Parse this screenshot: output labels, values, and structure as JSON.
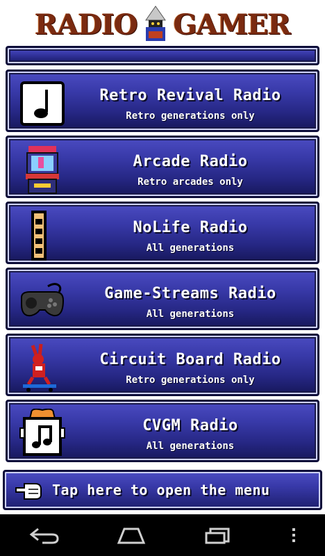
{
  "header": {
    "logo_left": "RADIO",
    "logo_right": "GAMER"
  },
  "stations": [
    {
      "title": "Retro Revival Radio",
      "subtitle": "Retro generations only",
      "icon": "music-note-icon"
    },
    {
      "title": "Arcade Radio",
      "subtitle": "Retro arcades only",
      "icon": "arcade-cabinet-icon"
    },
    {
      "title": "NoLife Radio",
      "subtitle": "All generations",
      "icon": "nolife-logo-icon"
    },
    {
      "title": "Game-Streams Radio",
      "subtitle": "All generations",
      "icon": "gamepad-icon"
    },
    {
      "title": "Circuit Board Radio",
      "subtitle": "Retro generations only",
      "icon": "rabbit-skateboard-icon"
    },
    {
      "title": "CVGM Radio",
      "subtitle": "All generations",
      "icon": "cvgm-music-icon"
    }
  ],
  "bottom": {
    "menu_label": "Tap here to open the menu",
    "icon": "pointing-hand-icon"
  },
  "colors": {
    "card_top": "#4b4cc2",
    "card_bottom": "#16175a",
    "border": "#0e0e3a"
  }
}
